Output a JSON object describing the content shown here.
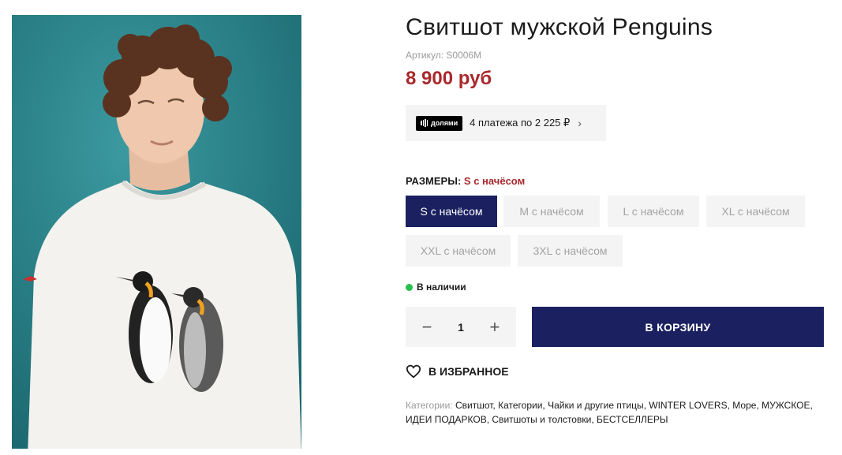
{
  "product": {
    "title": "Свитшот мужской Penguins",
    "sku": "Артикул: S0006M",
    "price": "8 900 руб"
  },
  "installments": {
    "badge": "долями",
    "text": "4 платежа по 2 225 ₽",
    "chevron": "›"
  },
  "sizes": {
    "label": "РАЗМЕРЫ:",
    "selected": "S с начёсом",
    "options": [
      "S с начёсом",
      "M с начёсом",
      "L с начёсом",
      "XL с начёсом",
      "XXL с начёсом",
      "3XL с начёсом"
    ]
  },
  "stock": {
    "text": "В наличии",
    "color": "#25c14c"
  },
  "quantity": {
    "minus": "−",
    "value": "1",
    "plus": "+"
  },
  "cart": {
    "label": "В КОРЗИНУ"
  },
  "favorites": {
    "label": "В ИЗБРАННОЕ",
    "icon": "heart-icon"
  },
  "categories": {
    "label": "Категории:",
    "list": "Свитшот, Категории, Чайки и другие птицы, WINTER LOVERS, Море, МУЖСКОЕ, ИДЕИ ПОДАРКОВ, Свитшоты и толстовки, БЕСТСЕЛЛЕРЫ"
  },
  "colors": {
    "accent": "#1b2160",
    "price": "#a8282c",
    "panel": "#f4f4f4"
  }
}
